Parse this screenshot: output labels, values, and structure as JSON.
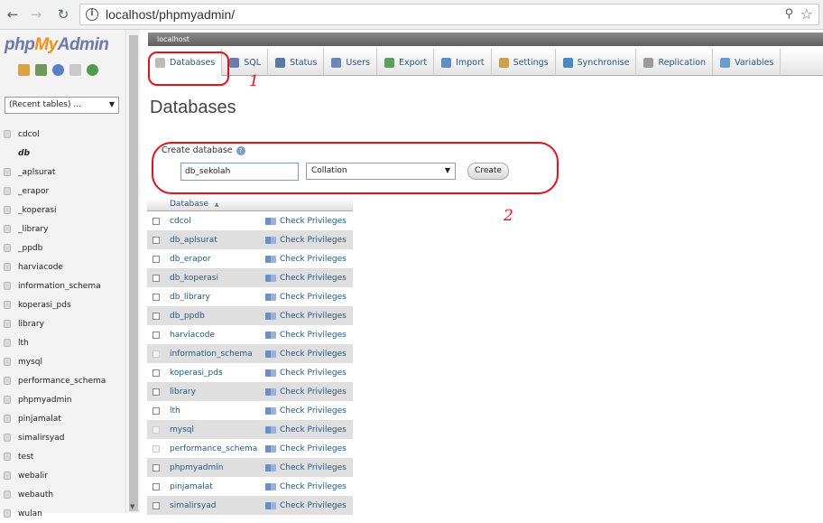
{
  "browser": {
    "url": "localhost/phpmyadmin/",
    "info_icon": "i"
  },
  "sidebar": {
    "logo": {
      "php": "php",
      "my": "My",
      "admin": "Admin"
    },
    "recent_tables": "(Recent tables) ...",
    "databases": [
      "cdcol",
      "db",
      "_aplsurat",
      "_erapor",
      "_koperasi",
      "_library",
      "_ppdb",
      "harviacode",
      "information_schema",
      "koperasi_pds",
      "library",
      "lth",
      "mysql",
      "performance_schema",
      "phpmyadmin",
      "pinjamalat",
      "simalirsyad",
      "test",
      "webalir",
      "webauth",
      "wulan"
    ]
  },
  "server_bar": {
    "label": "localhost"
  },
  "tabs": [
    "Databases",
    "SQL",
    "Status",
    "Users",
    "Export",
    "Import",
    "Settings",
    "Synchronise",
    "Replication",
    "Variables"
  ],
  "annotations": {
    "one": "1",
    "two": "2"
  },
  "main": {
    "title": "Databases",
    "create_label": "Create database",
    "db_name_value": "db_sekolah",
    "collation_selected": "Collation",
    "create_button": "Create"
  },
  "table": {
    "header": "Database",
    "sort_indicator": "▲",
    "action_label": "Check Privileges",
    "rows": [
      "cdcol",
      "db_aplsurat",
      "db_erapor",
      "db_koperasi",
      "db_library",
      "db_ppdb",
      "harviacode",
      "information_schema",
      "koperasi_pds",
      "library",
      "lth",
      "mysql",
      "performance_schema",
      "phpmyadmin",
      "pinjamalat",
      "simalirsyad"
    ]
  },
  "colors": {
    "link": "#235a81",
    "annotation_red": "#e8101a",
    "logo_blue": "#6c78af",
    "logo_orange": "#f29111"
  }
}
